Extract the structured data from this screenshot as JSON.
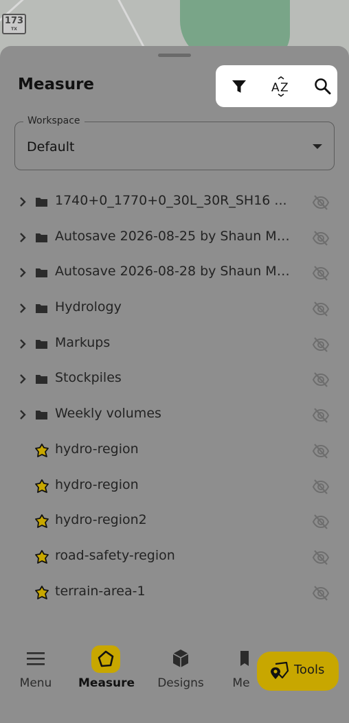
{
  "map": {
    "route_shield_number": "173",
    "route_shield_state": "TX"
  },
  "panel": {
    "title": "Measure"
  },
  "toolbar": {
    "filter_icon": "filter-icon",
    "sort_icon": "sort-az-icon",
    "search_icon": "search-icon"
  },
  "workspace": {
    "label": "Workspace",
    "value": "Default"
  },
  "items": [
    {
      "type": "folder",
      "label": "1740+0_1770+0_30L_30R_SH16 ...",
      "visible": false
    },
    {
      "type": "folder",
      "label": "Autosave 2026-08-25 by Shaun Ma...",
      "visible": false
    },
    {
      "type": "folder",
      "label": "Autosave 2026-08-28 by Shaun Ma...",
      "visible": false
    },
    {
      "type": "folder",
      "label": "Hydrology",
      "visible": false
    },
    {
      "type": "folder",
      "label": "Markups",
      "visible": false
    },
    {
      "type": "folder",
      "label": "Stockpiles",
      "visible": false
    },
    {
      "type": "folder",
      "label": "Weekly volumes",
      "visible": false
    },
    {
      "type": "region",
      "label": "hydro-region",
      "visible": false
    },
    {
      "type": "region",
      "label": "hydro-region",
      "visible": false
    },
    {
      "type": "region",
      "label": "hydro-region2",
      "visible": false
    },
    {
      "type": "region",
      "label": "road-safety-region",
      "visible": false
    },
    {
      "type": "region",
      "label": "terrain-area-1",
      "visible": false
    }
  ],
  "nav": {
    "menu": "Menu",
    "measure": "Measure",
    "designs": "Designs",
    "media": "Me"
  },
  "fab": {
    "label": "Tools"
  },
  "colors": {
    "accent": "#c8a700",
    "region_fill": "#c8a700"
  }
}
